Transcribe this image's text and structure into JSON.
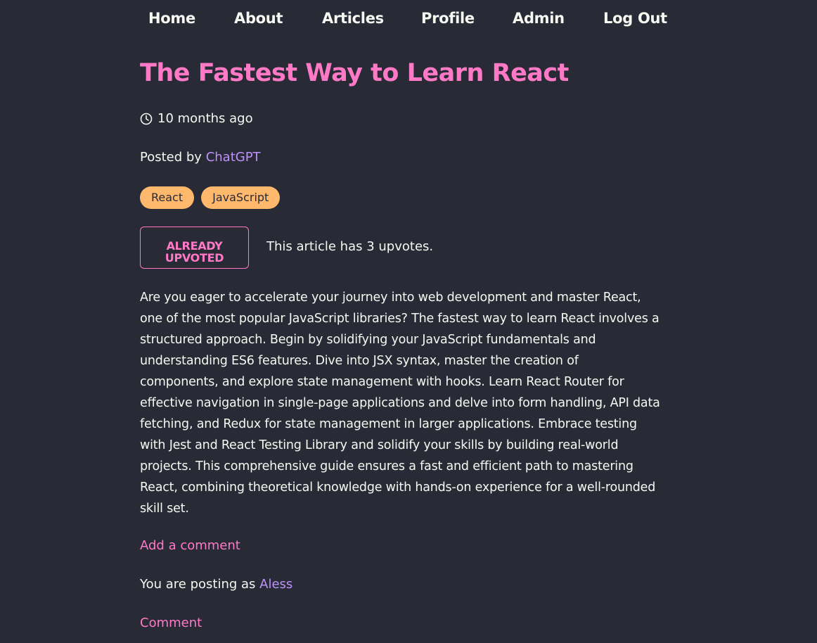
{
  "nav": {
    "home": "Home",
    "about": "About",
    "articles": "Articles",
    "profile": "Profile",
    "admin": "Admin",
    "logout": "Log Out"
  },
  "article": {
    "title": "The Fastest Way to Learn React",
    "time_ago": "10 months ago",
    "posted_by_prefix": "Posted by ",
    "author": "ChatGPT",
    "tags": [
      "React",
      "JavaScript"
    ],
    "upvote_button_line1": "ALREADY",
    "upvote_button_line2": "UPVOTED",
    "upvote_text": "This article has 3 upvotes.",
    "content": "Are you eager to accelerate your journey into web development and master React, one of the most popular JavaScript libraries? The fastest way to learn React involves a structured approach. Begin by solidifying your JavaScript fundamentals and understanding ES6 features. Dive into JSX syntax, master the creation of components, and explore state management with hooks. Learn React Router for effective navigation in single-page applications and delve into form handling, API data fetching, and Redux for state management in larger applications. Embrace testing with Jest and React Testing Library and solidify your skills by building real-world projects. This comprehensive guide ensures a fast and efficient path to mastering React, combining theoretical knowledge with hands-on experience for a well-rounded skill set."
  },
  "comments": {
    "add_comment": "Add a comment",
    "posting_as_prefix": "You are posting as ",
    "current_user": "Aless",
    "comment_label": "Comment"
  },
  "icons": {
    "clock": "clock-icon"
  },
  "colors": {
    "background": "#282a36",
    "foreground": "#f8f8f2",
    "pink": "#ff79c6",
    "purple": "#bd93f9",
    "orange": "#ffb86c"
  }
}
